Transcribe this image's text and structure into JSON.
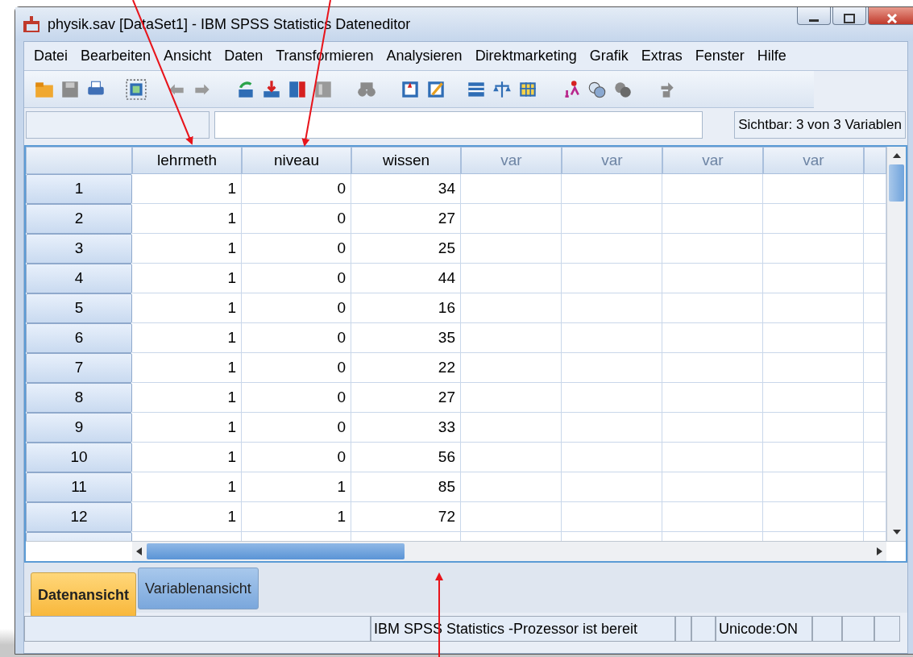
{
  "window": {
    "title": "physik.sav [DataSet1] - IBM SPSS Statistics Dateneditor"
  },
  "menu": [
    "Datei",
    "Bearbeiten",
    "Ansicht",
    "Daten",
    "Transformieren",
    "Analysieren",
    "Direktmarketing",
    "Grafik",
    "Extras",
    "Fenster",
    "Hilfe"
  ],
  "cell_bar": {
    "visible_vars": "Sichtbar: 3 von 3 Variablen"
  },
  "table": {
    "columns": [
      {
        "label": "lehrmeth",
        "defined": true
      },
      {
        "label": "niveau",
        "defined": true
      },
      {
        "label": "wissen",
        "defined": true
      },
      {
        "label": "var",
        "defined": false
      },
      {
        "label": "var",
        "defined": false
      },
      {
        "label": "var",
        "defined": false
      },
      {
        "label": "var",
        "defined": false
      }
    ],
    "rows": [
      {
        "number": "1",
        "cells": [
          "1",
          "0",
          "34"
        ]
      },
      {
        "number": "2",
        "cells": [
          "1",
          "0",
          "27"
        ]
      },
      {
        "number": "3",
        "cells": [
          "1",
          "0",
          "25"
        ]
      },
      {
        "number": "4",
        "cells": [
          "1",
          "0",
          "44"
        ]
      },
      {
        "number": "5",
        "cells": [
          "1",
          "0",
          "16"
        ]
      },
      {
        "number": "6",
        "cells": [
          "1",
          "0",
          "35"
        ]
      },
      {
        "number": "7",
        "cells": [
          "1",
          "0",
          "22"
        ]
      },
      {
        "number": "8",
        "cells": [
          "1",
          "0",
          "27"
        ]
      },
      {
        "number": "9",
        "cells": [
          "1",
          "0",
          "33"
        ]
      },
      {
        "number": "10",
        "cells": [
          "1",
          "0",
          "56"
        ]
      },
      {
        "number": "11",
        "cells": [
          "1",
          "1",
          "85"
        ]
      },
      {
        "number": "12",
        "cells": [
          "1",
          "1",
          "72"
        ]
      }
    ]
  },
  "view_tabs": [
    {
      "label": "Datenansicht",
      "selected": true
    },
    {
      "label": "Variablenansicht",
      "selected": false
    }
  ],
  "status_bar": {
    "processor": "IBM SPSS Statistics -Prozessor ist bereit",
    "encoding": "Unicode:ON"
  }
}
